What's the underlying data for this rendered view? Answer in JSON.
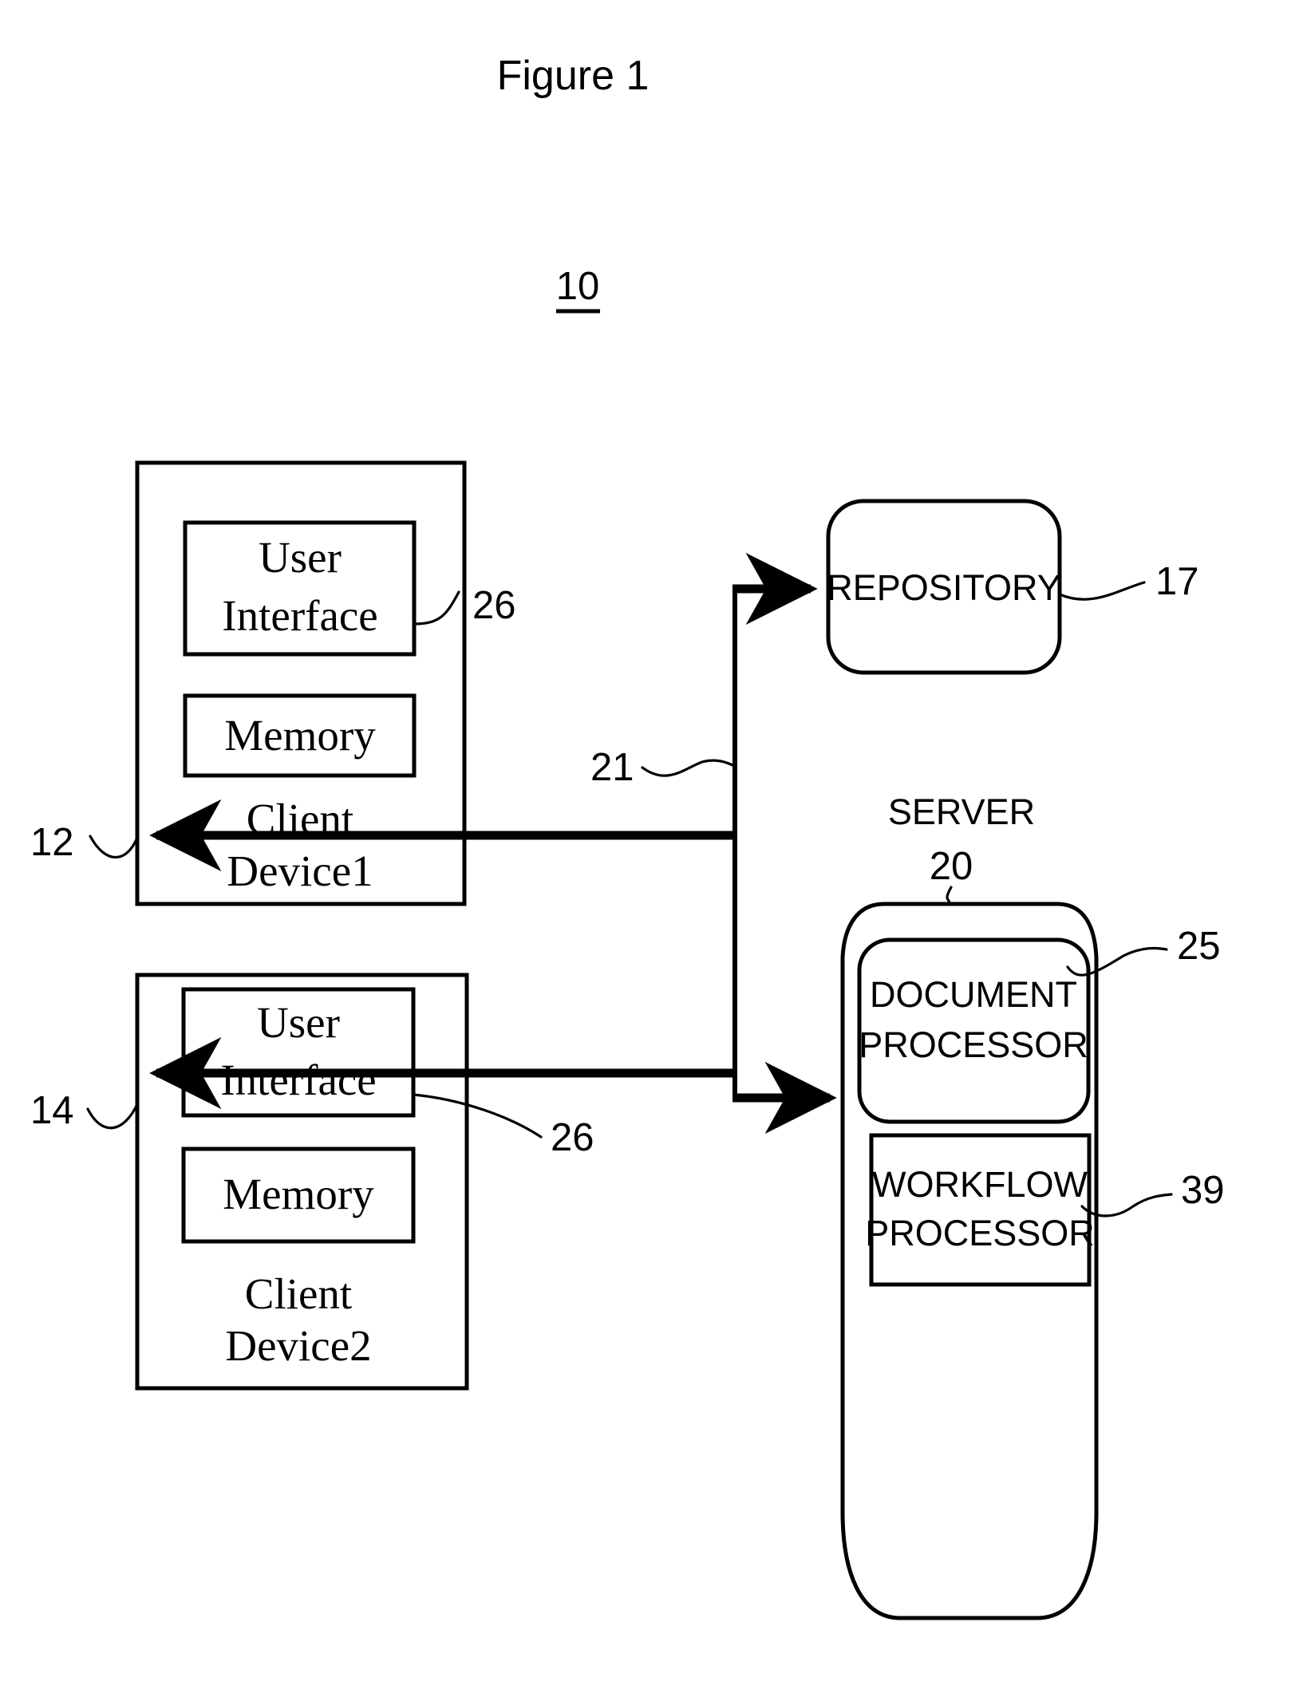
{
  "figure": {
    "title": "Figure 1",
    "system_number": "10"
  },
  "client_device_1": {
    "ref": "12",
    "label_line1": "Client",
    "label_line2": "Device1",
    "user_interface": {
      "line1": "User",
      "line2": "Interface",
      "ref": "26"
    },
    "memory": {
      "label": "Memory"
    }
  },
  "client_device_2": {
    "ref": "14",
    "label_line1": "Client",
    "label_line2": "Device2",
    "user_interface": {
      "line1": "User",
      "line2": "Interface",
      "ref": "26"
    },
    "memory": {
      "label": "Memory"
    }
  },
  "repository": {
    "label": "REPOSITORY",
    "ref": "17"
  },
  "network": {
    "ref": "21"
  },
  "server": {
    "label": "SERVER",
    "ref": "20",
    "document_processor": {
      "line1": "DOCUMENT",
      "line2": "PROCESSOR",
      "ref": "25"
    },
    "workflow_processor": {
      "line1": "WORKFLOW",
      "line2": "PROCESSOR",
      "ref": "39"
    }
  },
  "colors": {
    "ink": "#000000",
    "paper": "#ffffff"
  }
}
